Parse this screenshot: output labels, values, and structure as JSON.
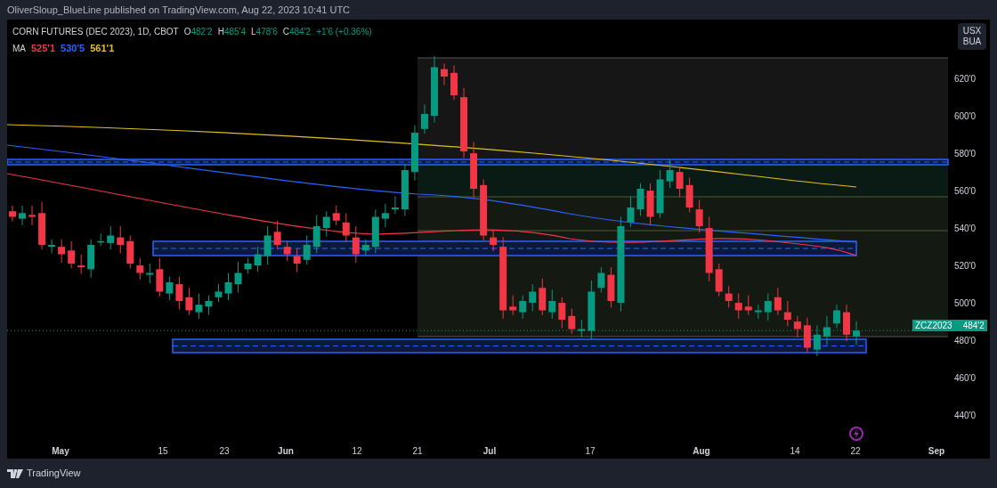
{
  "publish_line": "OliverSloup_BlueLine published on TradingView.com, Aug 22, 2023 10:41 UTC",
  "legend": {
    "symbol": "CORN FUTURES (DEC 2023), 1D, CBOT",
    "ohlc": [
      {
        "label": "O",
        "value": "482'2"
      },
      {
        "label": "H",
        "value": "485'4"
      },
      {
        "label": "L",
        "value": "478'6"
      },
      {
        "label": "C",
        "value": "484'2"
      }
    ],
    "change": "+1'6 (+0.36%)",
    "ma_label": "MA",
    "ma_values": [
      {
        "value": "525'1",
        "color": "#f23645"
      },
      {
        "value": "530'5",
        "color": "#2962ff"
      },
      {
        "value": "561'1",
        "color": "#e0c020"
      }
    ]
  },
  "currency_button": {
    "line_1": "USX",
    "line_2": "BUA"
  },
  "price_ticks": [
    "620'0",
    "600'0",
    "580'0",
    "560'0",
    "540'0",
    "520'0",
    "500'0",
    "480'0",
    "460'0",
    "440'0"
  ],
  "price_tag": {
    "symbol": "ZCZ2023",
    "price": "484'2"
  },
  "date_ticks": [
    {
      "label": "May",
      "kind": "month"
    },
    {
      "label": "15",
      "kind": "day"
    },
    {
      "label": "23",
      "kind": "day"
    },
    {
      "label": "Jun",
      "kind": "month"
    },
    {
      "label": "12",
      "kind": "day"
    },
    {
      "label": "21",
      "kind": "day"
    },
    {
      "label": "Jul",
      "kind": "month"
    },
    {
      "label": "17",
      "kind": "day"
    },
    {
      "label": "Aug",
      "kind": "month"
    },
    {
      "label": "14",
      "kind": "day"
    },
    {
      "label": "22",
      "kind": "day"
    },
    {
      "label": "Sep",
      "kind": "month"
    }
  ],
  "footer": {
    "brand": "TradingView"
  }
}
